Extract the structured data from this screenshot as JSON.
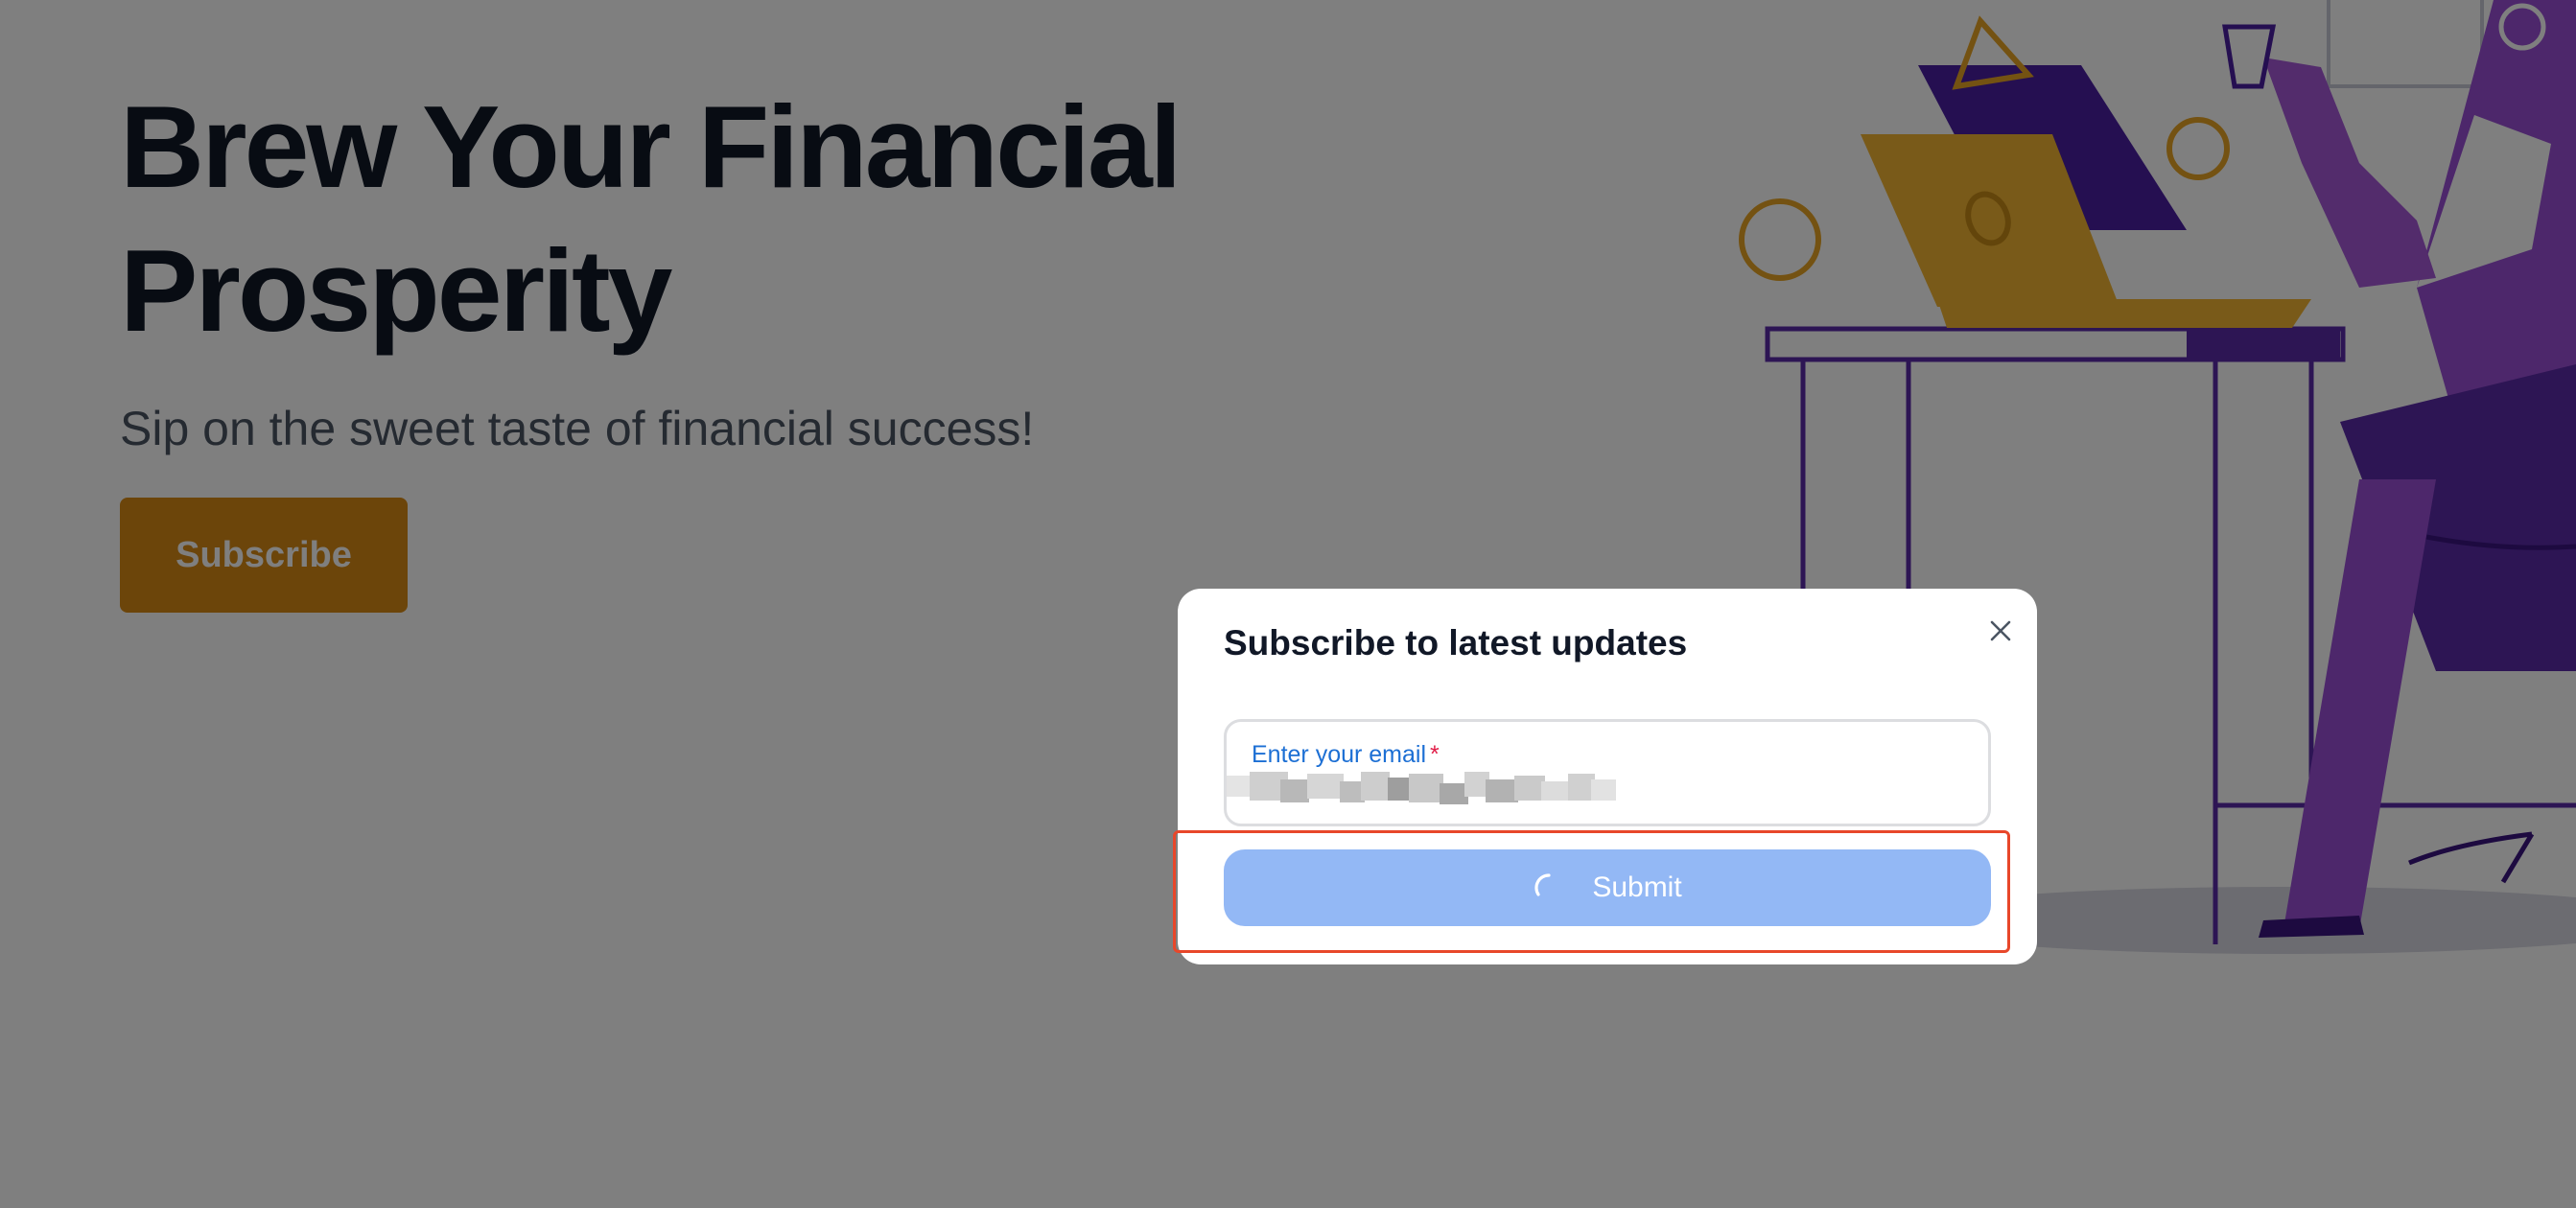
{
  "hero": {
    "title": "Brew Your Financial Prosperity",
    "subtitle": "Sip on the sweet taste of financial success!",
    "button_label": "Subscribe"
  },
  "modal": {
    "title": "Subscribe to latest updates",
    "close_icon": "close-icon",
    "email_field": {
      "label": "Enter your email",
      "required_mark": "*"
    },
    "submit": {
      "label": "Submit",
      "state": "loading",
      "icon": "loading-spinner-icon"
    }
  },
  "colors": {
    "hero_button": "#d98a14",
    "submit_button": "#93b8f5",
    "field_label": "#1c6fd4",
    "highlight": "#e8472a",
    "illustration_purple": "#6d2fc0",
    "illustration_gold": "#e8a524"
  }
}
